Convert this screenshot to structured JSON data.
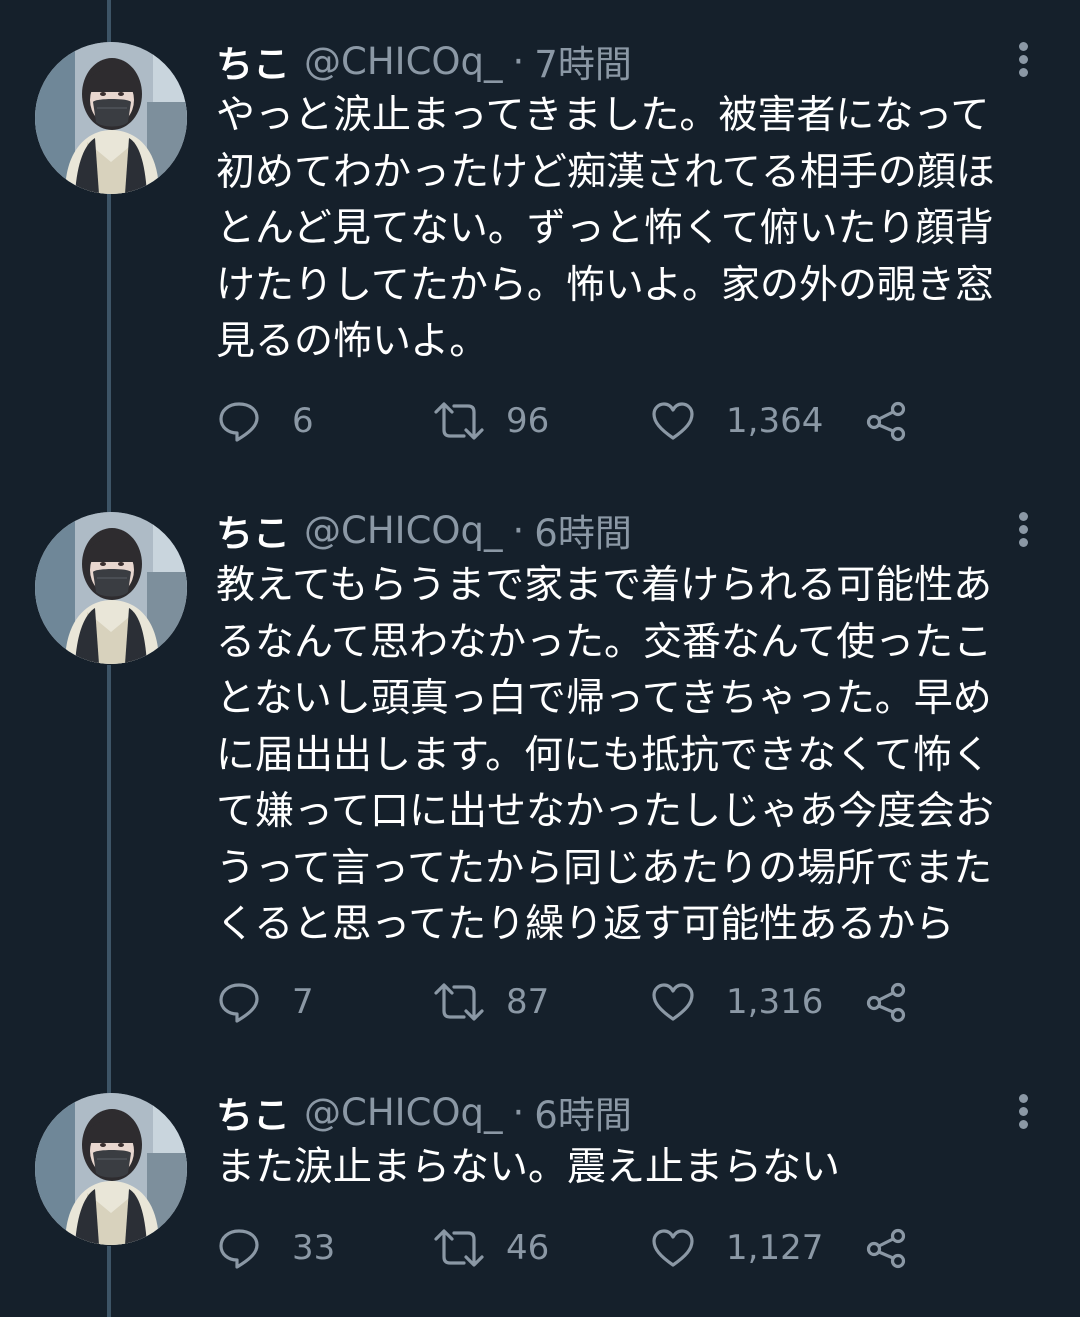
{
  "tweets": [
    {
      "display_name": "ちこ",
      "handle": "@CHICOq_",
      "separator": "·",
      "time": "7時間",
      "text": "やっと涙止まってきました。被害者になって\n初めてわかったけど痴漢されてる相手の顔ほ\nとんど見てない。ずっと怖くて俯いたり顔背\nけたりしてたから。怖いよ。家の外の覗き窓\n見るの怖いよ。",
      "replies": "6",
      "retweets": "96",
      "likes": "1,364"
    },
    {
      "display_name": "ちこ",
      "handle": "@CHICOq_",
      "separator": "·",
      "time": "6時間",
      "text": "教えてもらうまで家まで着けられる可能性あ\nるなんて思わなかった。交番なんて使ったこ\nとないし頭真っ白で帰ってきちゃった。早め\nに届出出します。何にも抵抗できなくて怖く\nて嫌って口に出せなかったしじゃあ今度会お\nうって言ってたから同じあたりの場所でまた\nくると思ってたり繰り返す可能性あるから",
      "replies": "7",
      "retweets": "87",
      "likes": "1,316"
    },
    {
      "display_name": "ちこ",
      "handle": "@CHICOq_",
      "separator": "·",
      "time": "6時間",
      "text": "また涙止まらない。震え止まらない",
      "replies": "33",
      "retweets": "46",
      "likes": "1,127"
    }
  ],
  "icons": {
    "reply": "reply-icon",
    "retweet": "retweet-icon",
    "like": "heart-icon",
    "share": "share-icon",
    "more": "more-vertical-icon"
  },
  "colors": {
    "background": "#15202b",
    "text": "#ffffff",
    "secondary_text": "#8b98a5",
    "thread_line": "#3d5466"
  }
}
